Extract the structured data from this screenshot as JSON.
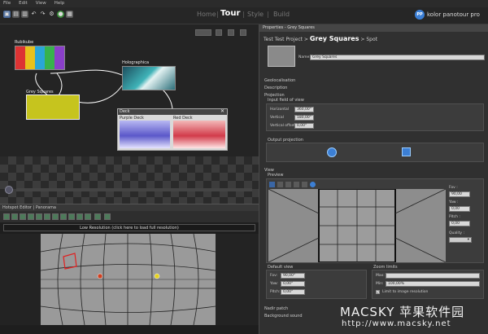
{
  "menu": [
    "File",
    "Edit",
    "View",
    "Help"
  ],
  "nav": {
    "home": "Home",
    "tour": "Tour",
    "style": "Style",
    "build": "Build"
  },
  "logo": {
    "mark": "PP",
    "text": "kolor panotour pro"
  },
  "graph": {
    "nodes": {
      "rubikube": "Rubikube",
      "holographica": "Holographica",
      "grey_squares": "Grey Squares",
      "deck": "Deck",
      "purple_deck": "Purple Deck",
      "red_deck": "Red Deck"
    }
  },
  "hotspot_editor": {
    "title": "Hotspot Editor | Panorama",
    "low_res": "Low Resolution (click here to load full resolution)"
  },
  "properties": {
    "panel_title": "Properties - Grey Squares",
    "breadcrumb_prefix": "Test Test Project >",
    "breadcrumb_name": "Grey Squares",
    "breadcrumb_suffix": "> Spot",
    "name_label": "Name:",
    "name_value": "Grey Squares",
    "sections": {
      "geolocalisation": "Geolocalisation",
      "description": "Description",
      "projection": "Projection",
      "input_fov": "Input field of view",
      "output_projection": "Output projection",
      "view": "View",
      "preview": "Preview",
      "default_view": "Default view",
      "zoom_limits": "Zoom limits",
      "nadir_patch": "Nadir patch",
      "background_sound": "Background sound"
    },
    "fov": {
      "horizontal_label": "Horizontal",
      "horizontal_value": "360,00°",
      "vertical_label": "Vertical",
      "vertical_value": "180,00°",
      "voffset_label": "Vertical offset",
      "voffset_value": "0,00°"
    },
    "preview_side": {
      "fov_label": "Fov :",
      "fov_value": "90,00",
      "yaw_label": "Yaw :",
      "yaw_value": "0,00",
      "pitch_label": "Pitch :",
      "pitch_value": "0,00",
      "quality_label": "Quality :"
    },
    "default_view": {
      "fov_label": "Fov:",
      "fov_value": "90,00°",
      "yaw_label": "Yaw:",
      "yaw_value": "0,00°",
      "pitch_label": "Pitch:",
      "pitch_value": "0,00°"
    },
    "zoom": {
      "max_label": "Max:",
      "min_label": "Min:",
      "min_value": "100,00%",
      "limit_label": "Limit to image resolution"
    }
  },
  "watermark": {
    "line1": "MACSKY 苹果软件园",
    "line2": "http://www.macsky.net"
  }
}
